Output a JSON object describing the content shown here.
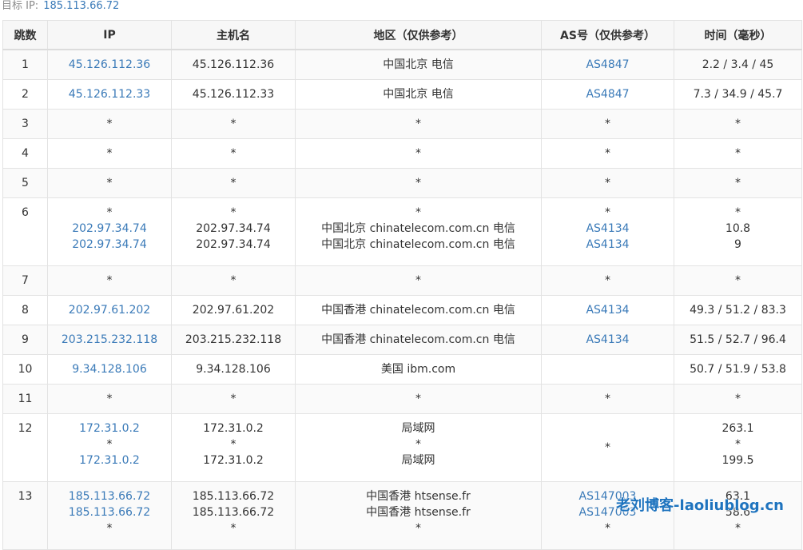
{
  "target": {
    "label": "目标 IP:",
    "ip": "185.113.66.72"
  },
  "headers": [
    "跳数",
    "IP",
    "主机名",
    "地区（仅供参考）",
    "AS号（仅供参考）",
    "时间（毫秒）"
  ],
  "rows": [
    {
      "hop": "1",
      "ip": [
        "45.126.112.36"
      ],
      "host": [
        "45.126.112.36"
      ],
      "region": [
        "中国北京 电信"
      ],
      "as": [
        "AS4847"
      ],
      "time": [
        "2.2 / 3.4 / 45"
      ]
    },
    {
      "hop": "2",
      "ip": [
        "45.126.112.33"
      ],
      "host": [
        "45.126.112.33"
      ],
      "region": [
        "中国北京 电信"
      ],
      "as": [
        "AS4847"
      ],
      "time": [
        "7.3 / 34.9 / 45.7"
      ]
    },
    {
      "hop": "3",
      "ip": [
        "*"
      ],
      "host": [
        "*"
      ],
      "region": [
        "*"
      ],
      "as": [
        "*"
      ],
      "time": [
        "*"
      ]
    },
    {
      "hop": "4",
      "ip": [
        "*"
      ],
      "host": [
        "*"
      ],
      "region": [
        "*"
      ],
      "as": [
        "*"
      ],
      "time": [
        "*"
      ]
    },
    {
      "hop": "5",
      "ip": [
        "*"
      ],
      "host": [
        "*"
      ],
      "region": [
        "*"
      ],
      "as": [
        "*"
      ],
      "time": [
        "*"
      ]
    },
    {
      "hop": "6",
      "ip": [
        "*",
        "202.97.34.74",
        "202.97.34.74"
      ],
      "host": [
        "*",
        "202.97.34.74",
        "202.97.34.74"
      ],
      "region": [
        "*",
        "中国北京 chinatelecom.com.cn 电信",
        "中国北京 chinatelecom.com.cn 电信"
      ],
      "as": [
        "*",
        "AS4134",
        "AS4134"
      ],
      "time": [
        "*",
        "10.8",
        "9"
      ]
    },
    {
      "hop": "7",
      "ip": [
        "*"
      ],
      "host": [
        "*"
      ],
      "region": [
        "*"
      ],
      "as": [
        "*"
      ],
      "time": [
        "*"
      ]
    },
    {
      "hop": "8",
      "ip": [
        "202.97.61.202"
      ],
      "host": [
        "202.97.61.202"
      ],
      "region": [
        "中国香港 chinatelecom.com.cn 电信"
      ],
      "as": [
        "AS4134"
      ],
      "time": [
        "49.3 / 51.2 / 83.3"
      ]
    },
    {
      "hop": "9",
      "ip": [
        "203.215.232.118"
      ],
      "host": [
        "203.215.232.118"
      ],
      "region": [
        "中国香港 chinatelecom.com.cn 电信"
      ],
      "as": [
        "AS4134"
      ],
      "time": [
        "51.5 / 52.7 / 96.4"
      ]
    },
    {
      "hop": "10",
      "ip": [
        "9.34.128.106"
      ],
      "host": [
        "9.34.128.106"
      ],
      "region": [
        "美国 ibm.com"
      ],
      "as": [
        ""
      ],
      "time": [
        "50.7 / 51.9 / 53.8"
      ]
    },
    {
      "hop": "11",
      "ip": [
        "*"
      ],
      "host": [
        "*"
      ],
      "region": [
        "*"
      ],
      "as": [
        "*"
      ],
      "time": [
        "*"
      ]
    },
    {
      "hop": "12",
      "ip": [
        "172.31.0.2",
        "*",
        "172.31.0.2"
      ],
      "host": [
        "172.31.0.2",
        "*",
        "172.31.0.2"
      ],
      "region": [
        "局域网",
        "*",
        "局域网"
      ],
      "as": [
        "*"
      ],
      "time": [
        "263.1",
        "*",
        "199.5"
      ]
    },
    {
      "hop": "13",
      "ip": [
        "185.113.66.72",
        "185.113.66.72",
        "*"
      ],
      "host": [
        "185.113.66.72",
        "185.113.66.72",
        "*"
      ],
      "region": [
        "中国香港 htsense.fr",
        "中国香港 htsense.fr",
        "*"
      ],
      "as": [
        "AS147003",
        "AS147003",
        "*"
      ],
      "time": [
        "63.1",
        "58.6",
        "*"
      ]
    }
  ],
  "watermark": "老刘博客-laoliublog.cn",
  "colors": {
    "link": "#3a7ab8",
    "header_bg": "#f7f7f7",
    "border": "#e3e3e3",
    "watermark": "#1e73be"
  }
}
